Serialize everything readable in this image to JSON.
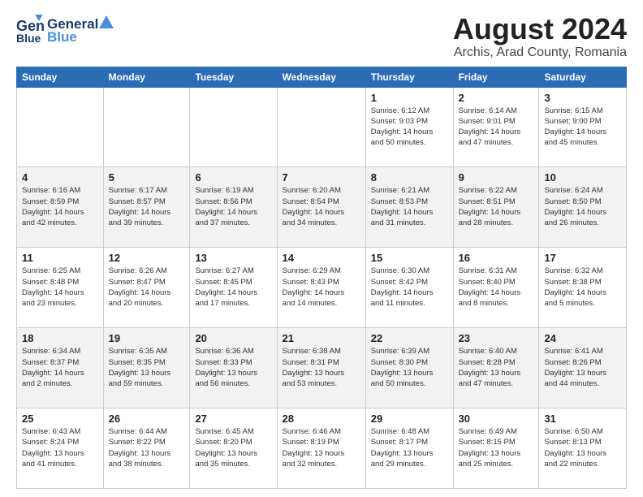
{
  "logo": {
    "line1": "General",
    "line2": "Blue"
  },
  "title": "August 2024",
  "location": "Archis, Arad County, Romania",
  "weekdays": [
    "Sunday",
    "Monday",
    "Tuesday",
    "Wednesday",
    "Thursday",
    "Friday",
    "Saturday"
  ],
  "weeks": [
    [
      {
        "day": "",
        "info": ""
      },
      {
        "day": "",
        "info": ""
      },
      {
        "day": "",
        "info": ""
      },
      {
        "day": "",
        "info": ""
      },
      {
        "day": "1",
        "info": "Sunrise: 6:12 AM\nSunset: 9:03 PM\nDaylight: 14 hours\nand 50 minutes."
      },
      {
        "day": "2",
        "info": "Sunrise: 6:14 AM\nSunset: 9:01 PM\nDaylight: 14 hours\nand 47 minutes."
      },
      {
        "day": "3",
        "info": "Sunrise: 6:15 AM\nSunset: 9:00 PM\nDaylight: 14 hours\nand 45 minutes."
      }
    ],
    [
      {
        "day": "4",
        "info": "Sunrise: 6:16 AM\nSunset: 8:59 PM\nDaylight: 14 hours\nand 42 minutes."
      },
      {
        "day": "5",
        "info": "Sunrise: 6:17 AM\nSunset: 8:57 PM\nDaylight: 14 hours\nand 39 minutes."
      },
      {
        "day": "6",
        "info": "Sunrise: 6:19 AM\nSunset: 8:56 PM\nDaylight: 14 hours\nand 37 minutes."
      },
      {
        "day": "7",
        "info": "Sunrise: 6:20 AM\nSunset: 8:54 PM\nDaylight: 14 hours\nand 34 minutes."
      },
      {
        "day": "8",
        "info": "Sunrise: 6:21 AM\nSunset: 8:53 PM\nDaylight: 14 hours\nand 31 minutes."
      },
      {
        "day": "9",
        "info": "Sunrise: 6:22 AM\nSunset: 8:51 PM\nDaylight: 14 hours\nand 28 minutes."
      },
      {
        "day": "10",
        "info": "Sunrise: 6:24 AM\nSunset: 8:50 PM\nDaylight: 14 hours\nand 26 minutes."
      }
    ],
    [
      {
        "day": "11",
        "info": "Sunrise: 6:25 AM\nSunset: 8:48 PM\nDaylight: 14 hours\nand 23 minutes."
      },
      {
        "day": "12",
        "info": "Sunrise: 6:26 AM\nSunset: 8:47 PM\nDaylight: 14 hours\nand 20 minutes."
      },
      {
        "day": "13",
        "info": "Sunrise: 6:27 AM\nSunset: 8:45 PM\nDaylight: 14 hours\nand 17 minutes."
      },
      {
        "day": "14",
        "info": "Sunrise: 6:29 AM\nSunset: 8:43 PM\nDaylight: 14 hours\nand 14 minutes."
      },
      {
        "day": "15",
        "info": "Sunrise: 6:30 AM\nSunset: 8:42 PM\nDaylight: 14 hours\nand 11 minutes."
      },
      {
        "day": "16",
        "info": "Sunrise: 6:31 AM\nSunset: 8:40 PM\nDaylight: 14 hours\nand 8 minutes."
      },
      {
        "day": "17",
        "info": "Sunrise: 6:32 AM\nSunset: 8:38 PM\nDaylight: 14 hours\nand 5 minutes."
      }
    ],
    [
      {
        "day": "18",
        "info": "Sunrise: 6:34 AM\nSunset: 8:37 PM\nDaylight: 14 hours\nand 2 minutes."
      },
      {
        "day": "19",
        "info": "Sunrise: 6:35 AM\nSunset: 8:35 PM\nDaylight: 13 hours\nand 59 minutes."
      },
      {
        "day": "20",
        "info": "Sunrise: 6:36 AM\nSunset: 8:33 PM\nDaylight: 13 hours\nand 56 minutes."
      },
      {
        "day": "21",
        "info": "Sunrise: 6:38 AM\nSunset: 8:31 PM\nDaylight: 13 hours\nand 53 minutes."
      },
      {
        "day": "22",
        "info": "Sunrise: 6:39 AM\nSunset: 8:30 PM\nDaylight: 13 hours\nand 50 minutes."
      },
      {
        "day": "23",
        "info": "Sunrise: 6:40 AM\nSunset: 8:28 PM\nDaylight: 13 hours\nand 47 minutes."
      },
      {
        "day": "24",
        "info": "Sunrise: 6:41 AM\nSunset: 8:26 PM\nDaylight: 13 hours\nand 44 minutes."
      }
    ],
    [
      {
        "day": "25",
        "info": "Sunrise: 6:43 AM\nSunset: 8:24 PM\nDaylight: 13 hours\nand 41 minutes."
      },
      {
        "day": "26",
        "info": "Sunrise: 6:44 AM\nSunset: 8:22 PM\nDaylight: 13 hours\nand 38 minutes."
      },
      {
        "day": "27",
        "info": "Sunrise: 6:45 AM\nSunset: 8:20 PM\nDaylight: 13 hours\nand 35 minutes."
      },
      {
        "day": "28",
        "info": "Sunrise: 6:46 AM\nSunset: 8:19 PM\nDaylight: 13 hours\nand 32 minutes."
      },
      {
        "day": "29",
        "info": "Sunrise: 6:48 AM\nSunset: 8:17 PM\nDaylight: 13 hours\nand 29 minutes."
      },
      {
        "day": "30",
        "info": "Sunrise: 6:49 AM\nSunset: 8:15 PM\nDaylight: 13 hours\nand 25 minutes."
      },
      {
        "day": "31",
        "info": "Sunrise: 6:50 AM\nSunset: 8:13 PM\nDaylight: 13 hours\nand 22 minutes."
      }
    ]
  ]
}
